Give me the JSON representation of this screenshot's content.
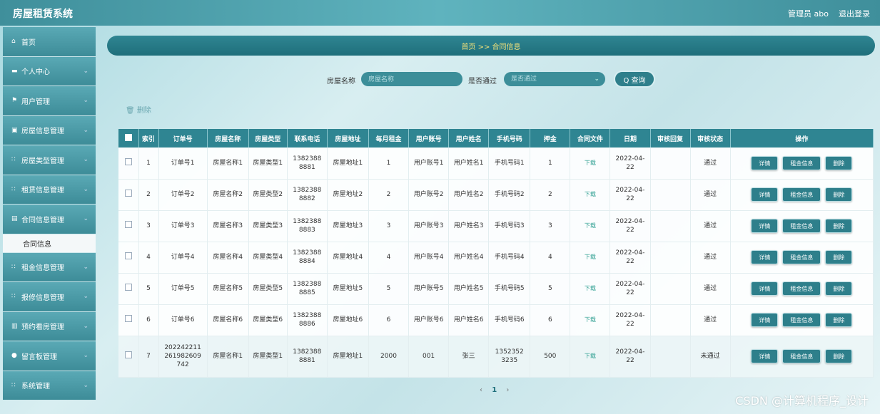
{
  "header": {
    "brand": "房屋租赁系统",
    "admin": "管理员 abo",
    "logout": "退出登录"
  },
  "sidebar": {
    "items": [
      {
        "icon": "⌂",
        "icon_name": "home-icon",
        "label": "首页",
        "chev": false
      },
      {
        "icon": "▬",
        "icon_name": "user-icon",
        "label": "个人中心",
        "chev": true
      },
      {
        "icon": "⚑",
        "icon_name": "flag-icon",
        "label": "用户管理",
        "chev": true
      },
      {
        "icon": "▣",
        "icon_name": "building-icon",
        "label": "房屋信息管理",
        "chev": true
      },
      {
        "icon": "∷",
        "icon_name": "grid-icon",
        "label": "房屋类型管理",
        "chev": true
      },
      {
        "icon": "∷",
        "icon_name": "grid-icon",
        "label": "租赁信息管理",
        "chev": true
      },
      {
        "icon": "▤",
        "icon_name": "document-icon",
        "label": "合同信息管理",
        "chev": true
      },
      {
        "sub": true,
        "label": "合同信息"
      },
      {
        "icon": "∷",
        "icon_name": "grid-icon",
        "label": "租金信息管理",
        "chev": true
      },
      {
        "icon": "∷",
        "icon_name": "grid-icon",
        "label": "报修信息管理",
        "chev": true
      },
      {
        "icon": "▥",
        "icon_name": "chart-icon",
        "label": "预约看房管理",
        "chev": true
      },
      {
        "icon": "●",
        "icon_name": "location-icon",
        "label": "留言板管理",
        "chev": true
      },
      {
        "icon": "∷",
        "icon_name": "grid-icon",
        "label": "系统管理",
        "chev": true
      }
    ]
  },
  "breadcrumb": {
    "text": "首页 >> 合同信息"
  },
  "search": {
    "name_label": "房屋名称",
    "name_placeholder": "房屋名称",
    "pass_label": "是否通过",
    "pass_placeholder": "是否通过",
    "query_label": "Q 查询"
  },
  "toolbar": {
    "delete_label": "🗑 删除"
  },
  "table": {
    "headers": [
      "",
      "索引",
      "订单号",
      "房屋名称",
      "房屋类型",
      "联系电话",
      "房屋地址",
      "每月租金",
      "用户账号",
      "用户姓名",
      "手机号码",
      "押金",
      "合同文件",
      "日期",
      "审核回复",
      "审核状态",
      "操作"
    ],
    "rows": [
      [
        "1",
        "订单号1",
        "房屋名称1",
        "房屋类型1",
        "1382388\n8881",
        "房屋地址1",
        "1",
        "用户账号1",
        "用户姓名1",
        "手机号码1",
        "1",
        "下载",
        "2022-04-\n22",
        "",
        "通过"
      ],
      [
        "2",
        "订单号2",
        "房屋名称2",
        "房屋类型2",
        "1382388\n8882",
        "房屋地址2",
        "2",
        "用户账号2",
        "用户姓名2",
        "手机号码2",
        "2",
        "下载",
        "2022-04-\n22",
        "",
        "通过"
      ],
      [
        "3",
        "订单号3",
        "房屋名称3",
        "房屋类型3",
        "1382388\n8883",
        "房屋地址3",
        "3",
        "用户账号3",
        "用户姓名3",
        "手机号码3",
        "3",
        "下载",
        "2022-04-\n22",
        "",
        "通过"
      ],
      [
        "4",
        "订单号4",
        "房屋名称4",
        "房屋类型4",
        "1382388\n8884",
        "房屋地址4",
        "4",
        "用户账号4",
        "用户姓名4",
        "手机号码4",
        "4",
        "下载",
        "2022-04-\n22",
        "",
        "通过"
      ],
      [
        "5",
        "订单号5",
        "房屋名称5",
        "房屋类型5",
        "1382388\n8885",
        "房屋地址5",
        "5",
        "用户账号5",
        "用户姓名5",
        "手机号码5",
        "5",
        "下载",
        "2022-04-\n22",
        "",
        "通过"
      ],
      [
        "6",
        "订单号6",
        "房屋名称6",
        "房屋类型6",
        "1382388\n8886",
        "房屋地址6",
        "6",
        "用户账号6",
        "用户姓名6",
        "手机号码6",
        "6",
        "下载",
        "2022-04-\n22",
        "",
        "通过"
      ],
      [
        "7",
        "202242211\n261982609\n742",
        "房屋名称1",
        "房屋类型1",
        "1382388\n8881",
        "房屋地址1",
        "2000",
        "001",
        "张三",
        "1352352\n3235",
        "500",
        "下载",
        "2022-04-\n22",
        "",
        "未通过"
      ]
    ],
    "actions": [
      "详情",
      "租金信息",
      "删除"
    ]
  },
  "pager": {
    "prev": "‹",
    "current": "1",
    "next": "›"
  },
  "watermark": "CSDN @计算机程序_设计",
  "colors": {
    "primary": "#2f8592",
    "accent": "#f3e27a",
    "link": "#2a9d8f"
  }
}
